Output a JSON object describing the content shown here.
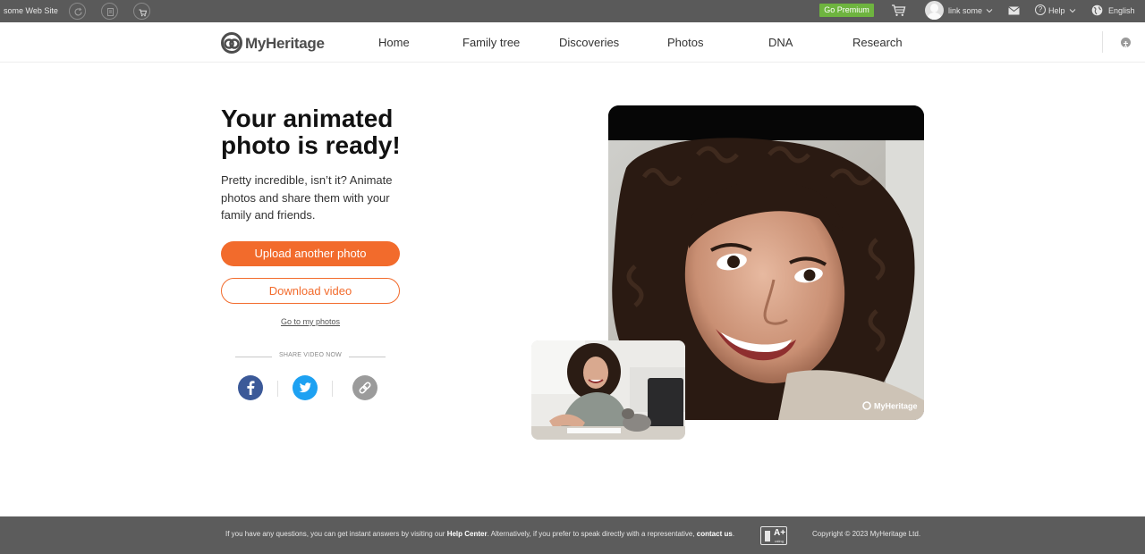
{
  "topbar": {
    "site_name": "some Web Site",
    "premium_label": "Go Premium",
    "user_name": "link some",
    "help_label": "Help",
    "language": "English"
  },
  "nav": {
    "logo_text": "MyHeritage",
    "items": [
      "Home",
      "Family tree",
      "Discoveries",
      "Photos",
      "DNA",
      "Research"
    ]
  },
  "hero": {
    "title_line1": "Your animated",
    "title_line2": "photo is ready!",
    "description": "Pretty incredible, isn’t it? Animate photos and share them with your family and friends.",
    "upload_button": "Upload another photo",
    "download_button": "Download video",
    "go_to_photos": "Go to my photos",
    "share_label": "SHARE VIDEO NOW",
    "watermark": "MyHeritage"
  },
  "footer": {
    "text_before": "If you have any questions, you can get instant answers by visiting our ",
    "help_center": "Help Center",
    "text_middle": ". Alternatively, if you prefer to speak directly with a representative, ",
    "contact_us": "contact us",
    "text_after": ".",
    "bbb_rating": "A+",
    "bbb_sub": "rating",
    "copyright": "Copyright © 2023 MyHeritage Ltd."
  },
  "colors": {
    "accent": "#f26b2c",
    "premium": "#6eb43f",
    "facebook": "#3b5998",
    "twitter": "#1da1f2",
    "topbar": "#5a5a5a"
  },
  "icons": [
    "refresh-icon",
    "document-icon",
    "basket-icon",
    "cart-icon",
    "mail-icon",
    "help-icon",
    "globe-icon",
    "accessibility-icon",
    "facebook-icon",
    "twitter-icon",
    "link-icon"
  ]
}
